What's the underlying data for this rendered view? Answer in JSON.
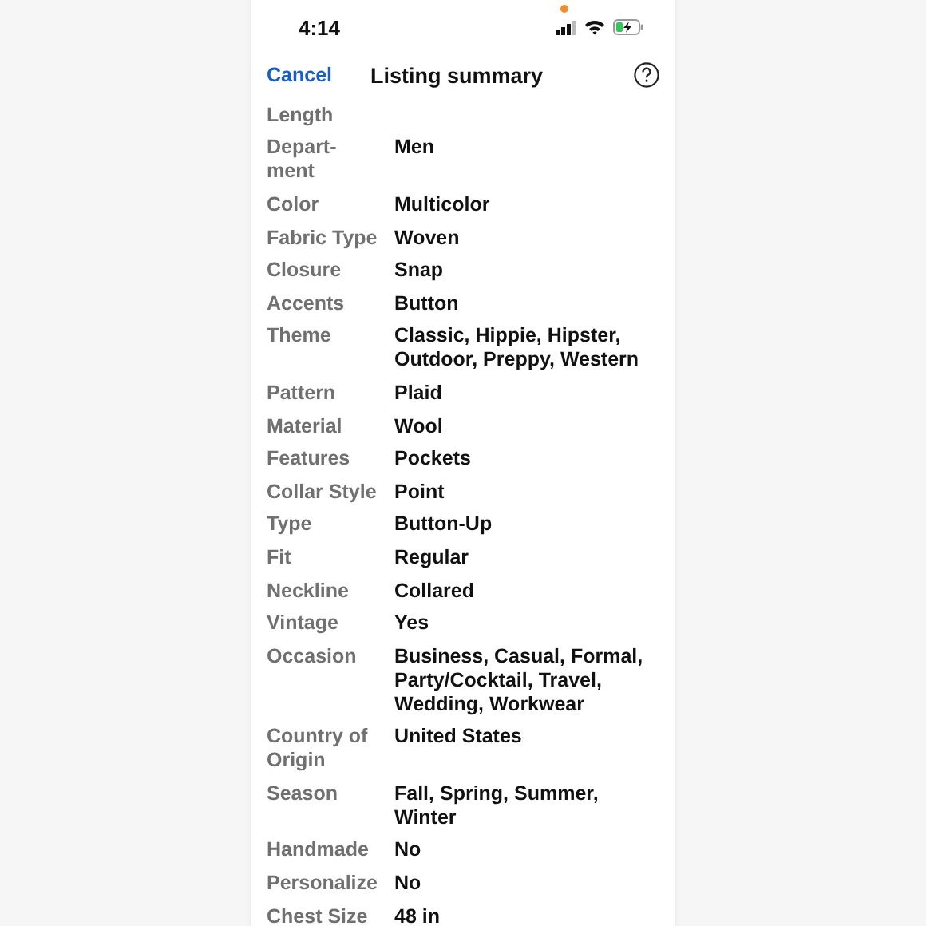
{
  "status_bar": {
    "time": "4:14"
  },
  "nav": {
    "cancel": "Cancel",
    "title": "Listing summary"
  },
  "rows": [
    {
      "label": [
        "Length"
      ],
      "value": []
    },
    {
      "label": [
        "Depart-",
        "ment"
      ],
      "value": [
        "Men"
      ]
    },
    {
      "label": [
        "Color"
      ],
      "value": [
        "Multicolor"
      ]
    },
    {
      "label": [
        "Fabric Type"
      ],
      "value": [
        "Woven"
      ]
    },
    {
      "label": [
        "Closure"
      ],
      "value": [
        "Snap"
      ]
    },
    {
      "label": [
        "Accents"
      ],
      "value": [
        "Button"
      ]
    },
    {
      "label": [
        "Theme"
      ],
      "value": [
        "Classic, Hippie, Hipster,",
        "Outdoor, Preppy, Western"
      ]
    },
    {
      "label": [
        "Pattern"
      ],
      "value": [
        "Plaid"
      ]
    },
    {
      "label": [
        "Material"
      ],
      "value": [
        "Wool"
      ]
    },
    {
      "label": [
        "Features"
      ],
      "value": [
        "Pockets"
      ]
    },
    {
      "label": [
        "Collar Style"
      ],
      "value": [
        "Point"
      ]
    },
    {
      "label": [
        "Type"
      ],
      "value": [
        "Button-Up"
      ]
    },
    {
      "label": [
        "Fit"
      ],
      "value": [
        "Regular"
      ]
    },
    {
      "label": [
        "Neckline"
      ],
      "value": [
        "Collared"
      ]
    },
    {
      "label": [
        "Vintage"
      ],
      "value": [
        "Yes"
      ]
    },
    {
      "label": [
        "Occasion"
      ],
      "value": [
        "Business, Casual, Formal,",
        "Party/Cocktail, Travel,",
        "Wedding, Workwear"
      ]
    },
    {
      "label": [
        "Country of",
        "Origin"
      ],
      "value": [
        "United States"
      ]
    },
    {
      "label": [
        "Season"
      ],
      "value": [
        "Fall, Spring, Summer,",
        "Winter"
      ]
    },
    {
      "label": [
        "Handmade"
      ],
      "value": [
        "No"
      ]
    },
    {
      "label": [
        "Personalize"
      ],
      "value": [
        "No"
      ]
    },
    {
      "label": [
        "Chest Size"
      ],
      "value": [
        "48 in"
      ]
    }
  ]
}
